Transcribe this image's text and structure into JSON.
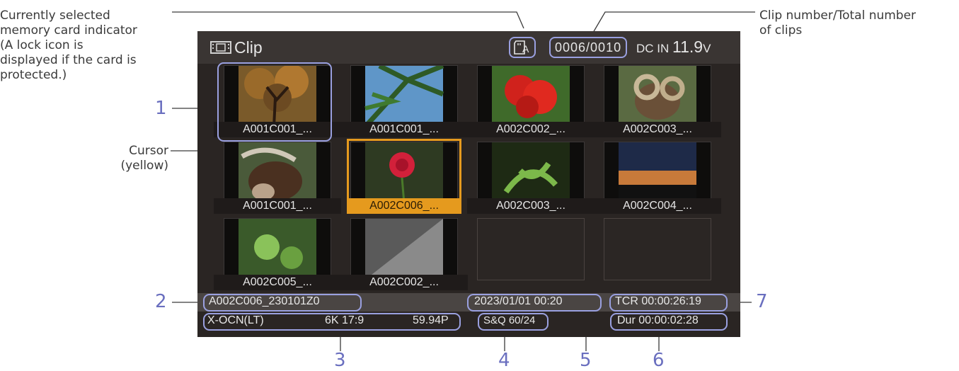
{
  "annotations": {
    "card_indicator": [
      "Currently selected",
      "memory card indicator",
      "(A lock icon is",
      "displayed if the card is",
      "protected.)"
    ],
    "clip_number": [
      "Clip number/Total number",
      "of clips"
    ],
    "cursor": [
      "Cursor",
      "(yellow)"
    ],
    "callouts": [
      "1",
      "2",
      "3",
      "4",
      "5",
      "6",
      "7"
    ]
  },
  "screen": {
    "title": "Clip",
    "card_slot": "A",
    "clip_counter": "0006/0010",
    "dc_in_label": "DC IN",
    "voltage": "11.9",
    "voltage_unit": "V"
  },
  "thumbnails": [
    {
      "label": "A001C001_...",
      "icon": "tree-image"
    },
    {
      "label": "A001C001_...",
      "icon": "palm-sky-image"
    },
    {
      "label": "A002C002_...",
      "icon": "red-flower-image"
    },
    {
      "label": "A002C003_...",
      "icon": "ram-image"
    },
    {
      "label": "A001C001_...",
      "icon": "buffalo-image"
    },
    {
      "label": "A002C006_...",
      "icon": "rose-image",
      "selected": true
    },
    {
      "label": "A002C003_...",
      "icon": "plant-image"
    },
    {
      "label": "A002C004_...",
      "icon": "sunset-image"
    },
    {
      "label": "A002C005_...",
      "icon": "leaves-image"
    },
    {
      "label": "A002C002_...",
      "icon": "wall-image"
    },
    {
      "label": "",
      "icon": "empty"
    },
    {
      "label": "",
      "icon": "empty"
    }
  ],
  "info": {
    "clip_name": "A002C006_230101Z0",
    "date_time": "2023/01/01 00:20",
    "tcr": "TCR 00:00:26:19",
    "codec": "X-OCN(LT)",
    "resolution": "6K 17:9",
    "frame_rate": "59.94P",
    "sq": "S&Q 60/24",
    "duration": "Dur 00:00:02:28"
  },
  "colors": {
    "accent_ring": "#9aa0e0",
    "cursor": "#e59a1e",
    "screen_bg": "#2a2523"
  }
}
